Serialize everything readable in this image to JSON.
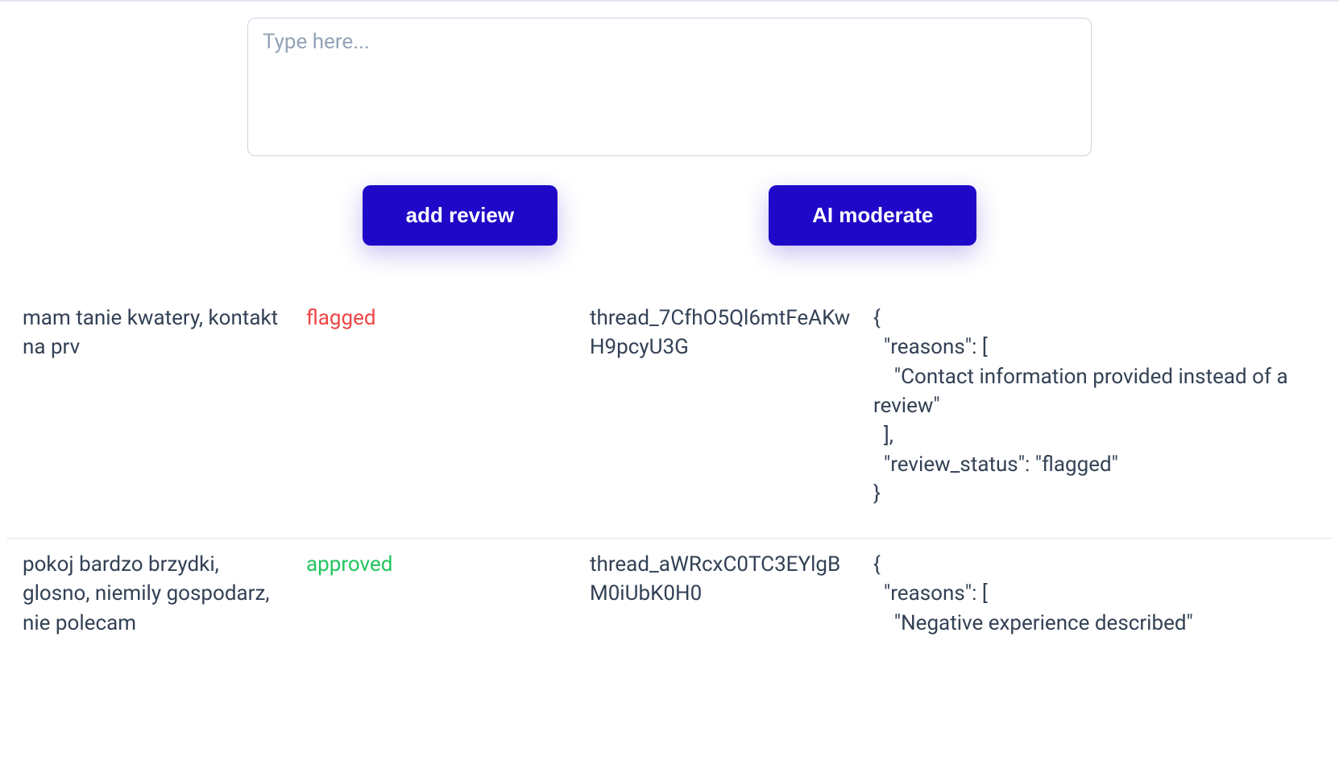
{
  "input": {
    "placeholder": "Type here..."
  },
  "buttons": {
    "add_review": "add review",
    "ai_moderate": "AI moderate"
  },
  "rows": [
    {
      "review": "mam tanie kwatery, kontakt na prv",
      "status": "flagged",
      "status_class": "status-flagged",
      "thread": "thread_7CfhO5Ql6mtFeAKwH9pcyU3G",
      "result": "{\n  \"reasons\": [\n    \"Contact information provided instead of a review\"\n  ],\n  \"review_status\": \"flagged\"\n}"
    },
    {
      "review": "pokoj bardzo brzydki, glosno, niemily gospodarz, nie polecam",
      "status": "approved",
      "status_class": "status-approved",
      "thread": "thread_aWRcxC0TC3EYlgBM0iUbK0H0",
      "result": "{\n  \"reasons\": [\n    \"Negative experience described\""
    }
  ]
}
